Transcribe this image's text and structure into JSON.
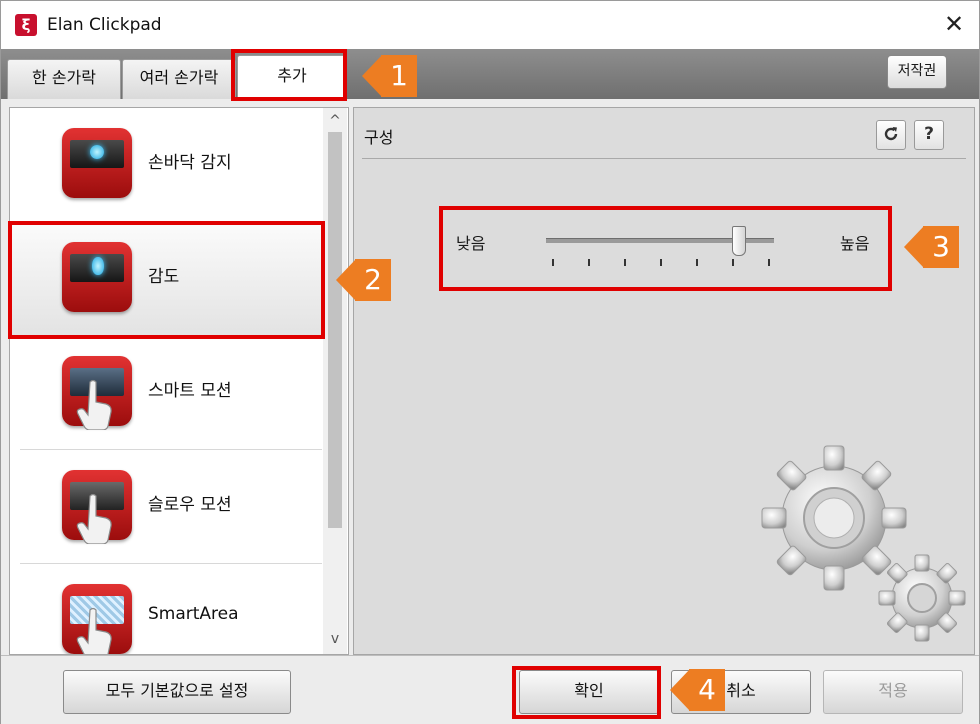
{
  "window": {
    "title": "Elan Clickpad",
    "icon": "elan-logo-icon",
    "close": "✕"
  },
  "tabs": [
    {
      "label": "한 손가락",
      "active": false
    },
    {
      "label": "여러 손가락",
      "active": false
    },
    {
      "label": "추가",
      "active": true
    }
  ],
  "copyright_button": "저작권",
  "features": [
    {
      "label": "손바닥 감지",
      "icon": "palm-detection-icon"
    },
    {
      "label": "감도",
      "icon": "sensitivity-icon",
      "selected": true
    },
    {
      "label": "스마트 모션",
      "icon": "smart-motion-icon"
    },
    {
      "label": "슬로우 모션",
      "icon": "slow-motion-icon"
    },
    {
      "label": "SmartArea",
      "icon": "smartarea-icon"
    }
  ],
  "scroll": {
    "up": "^",
    "down": "v"
  },
  "config": {
    "title": "구성",
    "refresh_icon": "refresh-icon",
    "help_label": "?",
    "slider": {
      "low_label": "낮음",
      "high_label": "높음",
      "level": 0.84,
      "ticks": 7
    }
  },
  "footer": {
    "reset_label": "모두 기본값으로 설정",
    "ok_label": "확인",
    "cancel_label": "취소",
    "apply_label": "적용",
    "apply_enabled": false
  },
  "callouts": [
    "1",
    "2",
    "3",
    "4"
  ],
  "colors": {
    "highlight": "#e00000",
    "callout": "#ed7d22",
    "icon_red": "#c8102e"
  }
}
